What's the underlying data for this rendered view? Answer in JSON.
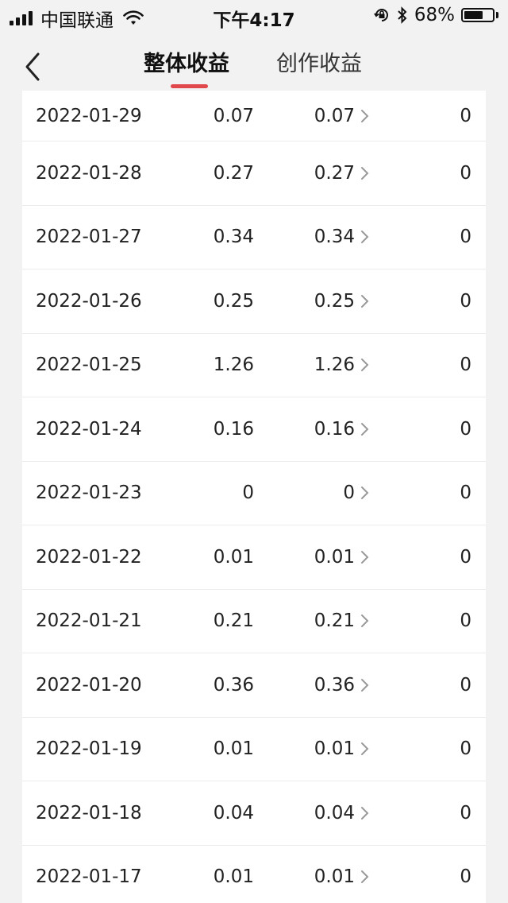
{
  "status_bar": {
    "carrier": "中国联通",
    "time": "下午4:17",
    "battery_percent": "68%",
    "battery_level": 0.68,
    "icons": [
      "signal-icon",
      "wifi-icon",
      "orientation-lock-icon",
      "bluetooth-icon",
      "battery-icon"
    ]
  },
  "nav": {
    "tabs": [
      {
        "label": "整体收益",
        "active": true
      },
      {
        "label": "创作收益",
        "active": false
      }
    ],
    "accent_color": "#e0484c"
  },
  "rows": [
    {
      "date": "2022-01-29",
      "total": "0.07",
      "creation": "0.07",
      "other": "0"
    },
    {
      "date": "2022-01-28",
      "total": "0.27",
      "creation": "0.27",
      "other": "0"
    },
    {
      "date": "2022-01-27",
      "total": "0.34",
      "creation": "0.34",
      "other": "0"
    },
    {
      "date": "2022-01-26",
      "total": "0.25",
      "creation": "0.25",
      "other": "0"
    },
    {
      "date": "2022-01-25",
      "total": "1.26",
      "creation": "1.26",
      "other": "0"
    },
    {
      "date": "2022-01-24",
      "total": "0.16",
      "creation": "0.16",
      "other": "0"
    },
    {
      "date": "2022-01-23",
      "total": "0",
      "creation": "0",
      "other": "0"
    },
    {
      "date": "2022-01-22",
      "total": "0.01",
      "creation": "0.01",
      "other": "0"
    },
    {
      "date": "2022-01-21",
      "total": "0.21",
      "creation": "0.21",
      "other": "0"
    },
    {
      "date": "2022-01-20",
      "total": "0.36",
      "creation": "0.36",
      "other": "0"
    },
    {
      "date": "2022-01-19",
      "total": "0.01",
      "creation": "0.01",
      "other": "0"
    },
    {
      "date": "2022-01-18",
      "total": "0.04",
      "creation": "0.04",
      "other": "0"
    },
    {
      "date": "2022-01-17",
      "total": "0.01",
      "creation": "0.01",
      "other": "0"
    }
  ]
}
